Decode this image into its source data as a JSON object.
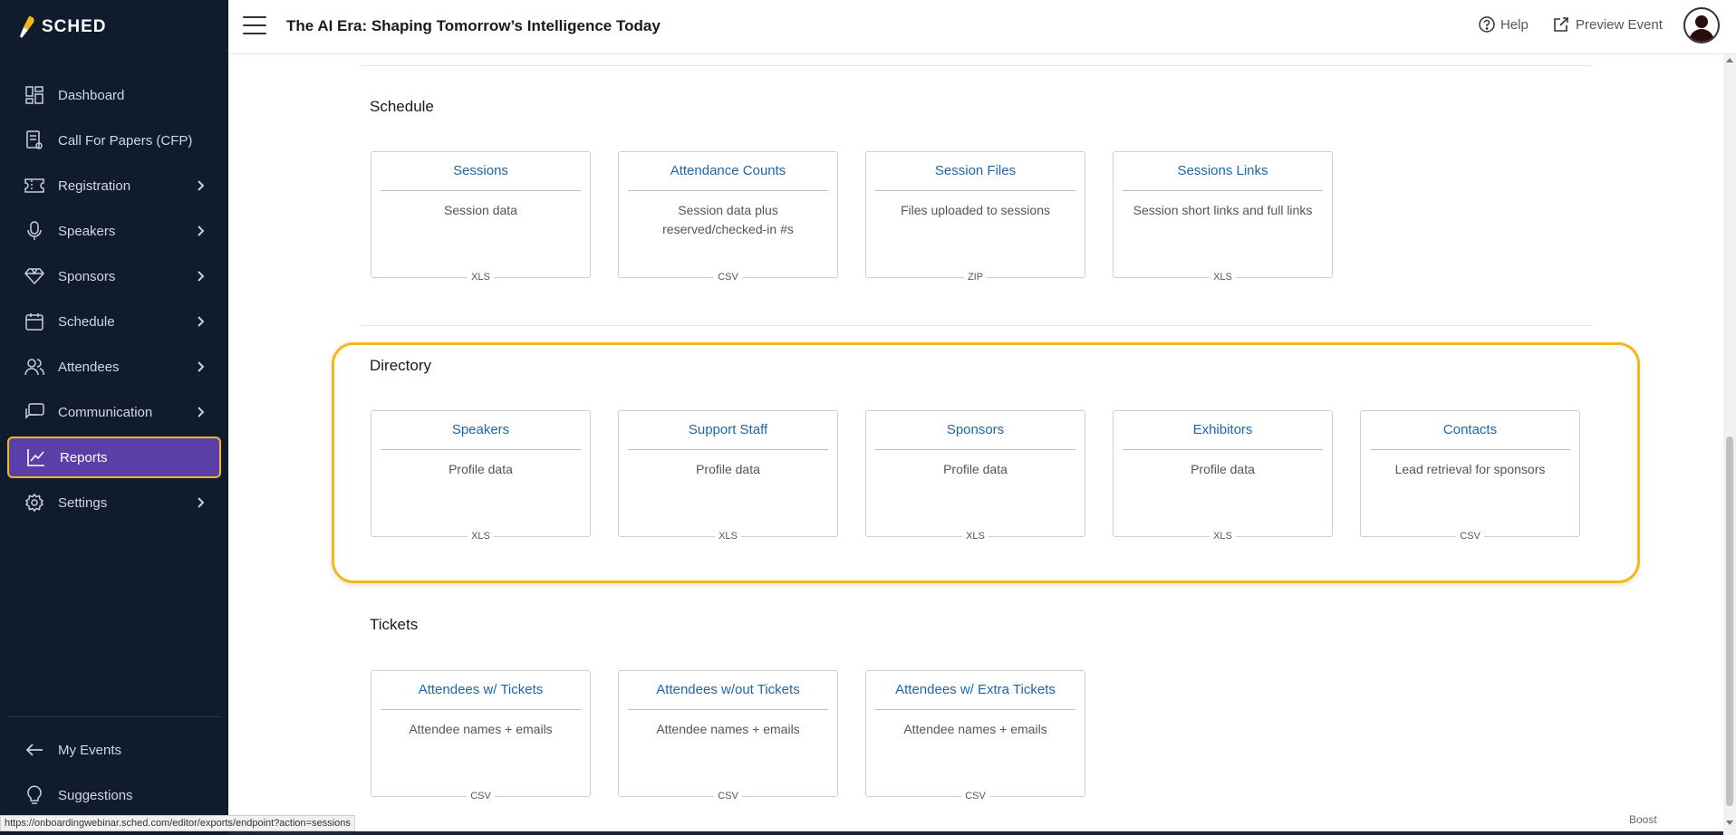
{
  "app": {
    "logo_text": "SCHED",
    "event_title": "The AI Era: Shaping Tomorrow’s Intelligence Today",
    "accent_color": "#5b3fa8",
    "highlight_color": "#f2b81c"
  },
  "header": {
    "help_label": "Help",
    "preview_label": "Preview Event"
  },
  "sidebar": {
    "items": [
      {
        "label": "Dashboard",
        "icon": "dashboard-icon",
        "chevron": false
      },
      {
        "label": "Call For Papers (CFP)",
        "icon": "document-icon",
        "chevron": false
      },
      {
        "label": "Registration",
        "icon": "ticket-icon",
        "chevron": true
      },
      {
        "label": "Speakers",
        "icon": "microphone-icon",
        "chevron": true
      },
      {
        "label": "Sponsors",
        "icon": "diamond-icon",
        "chevron": true
      },
      {
        "label": "Schedule",
        "icon": "calendar-icon",
        "chevron": true
      },
      {
        "label": "Attendees",
        "icon": "users-icon",
        "chevron": true
      },
      {
        "label": "Communication",
        "icon": "chat-icon",
        "chevron": true
      },
      {
        "label": "Reports",
        "icon": "chart-icon",
        "chevron": false,
        "active": true
      },
      {
        "label": "Settings",
        "icon": "gear-icon",
        "chevron": true
      }
    ],
    "bottom": [
      {
        "label": "My Events",
        "icon": "arrow-left-icon"
      },
      {
        "label": "Suggestions",
        "icon": "lightbulb-icon"
      }
    ]
  },
  "sections": {
    "schedule": {
      "title": "Schedule",
      "cards": [
        {
          "title": "Sessions",
          "desc": "Session data",
          "format": "XLS"
        },
        {
          "title": "Attendance Counts",
          "desc": "Session data plus reserved/checked-in #s",
          "format": "CSV"
        },
        {
          "title": "Session Files",
          "desc": "Files uploaded to sessions",
          "format": "ZIP"
        },
        {
          "title": "Sessions Links",
          "desc": "Session short links and full links",
          "format": "XLS"
        }
      ]
    },
    "directory": {
      "title": "Directory",
      "cards": [
        {
          "title": "Speakers",
          "desc": "Profile data",
          "format": "XLS"
        },
        {
          "title": "Support Staff",
          "desc": "Profile data",
          "format": "XLS"
        },
        {
          "title": "Sponsors",
          "desc": "Profile data",
          "format": "XLS"
        },
        {
          "title": "Exhibitors",
          "desc": "Profile data",
          "format": "XLS"
        },
        {
          "title": "Contacts",
          "desc": "Lead retrieval for sponsors",
          "format": "CSV"
        }
      ]
    },
    "tickets": {
      "title": "Tickets",
      "cards": [
        {
          "title": "Attendees w/ Tickets",
          "desc": "Attendee names + emails",
          "format": "CSV"
        },
        {
          "title": "Attendees w/out Tickets",
          "desc": "Attendee names + emails",
          "format": "CSV"
        },
        {
          "title": "Attendees w/ Extra Tickets",
          "desc": "Attendee names + emails",
          "format": "CSV"
        }
      ]
    }
  },
  "status_bar": {
    "url": "https://onboardingwebinar.sched.com/editor/exports/endpoint?action=sessions",
    "boost_label": "Boost"
  }
}
